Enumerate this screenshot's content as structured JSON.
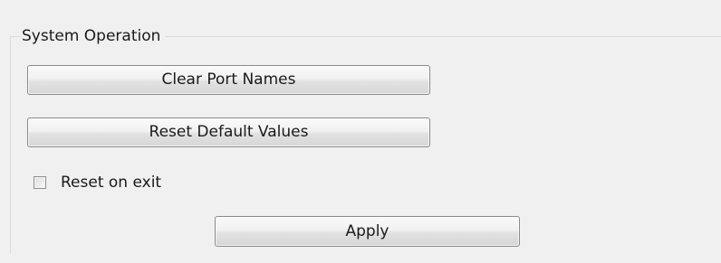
{
  "group": {
    "title": "System Operation"
  },
  "buttons": {
    "clear_port_names": "Clear Port Names",
    "reset_default_values": "Reset Default Values",
    "apply": "Apply"
  },
  "options": {
    "reset_on_exit": {
      "label": "Reset on exit",
      "checked": false
    }
  }
}
